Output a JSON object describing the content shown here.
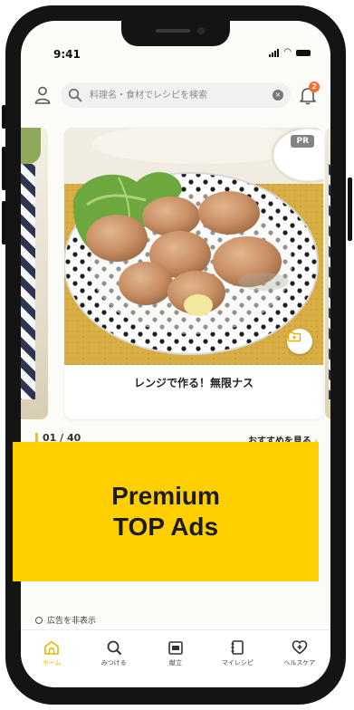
{
  "status_bar": {
    "time": "9:41"
  },
  "search": {
    "placeholder": "料理名・食材でレシピを検索"
  },
  "notifications": {
    "badge_count": "2"
  },
  "featured": {
    "pr_label": "PR",
    "recipe_title": "レンジで作る！無限ナス",
    "pager": "01 / 40",
    "see_more_label": "おすすめを見る"
  },
  "ad_banner": {
    "line1": "Premium",
    "line2": "TOP Ads"
  },
  "hide_ads_label": "広告を非表示",
  "tab_bar": {
    "items": [
      {
        "label": "ホーム",
        "icon": "home-icon",
        "active": true
      },
      {
        "label": "みつける",
        "icon": "search-icon",
        "active": false
      },
      {
        "label": "献立",
        "icon": "calendar-icon",
        "active": false
      },
      {
        "label": "マイレシピ",
        "icon": "notebook-icon",
        "active": false
      },
      {
        "label": "ヘルスケア",
        "icon": "heart-icon",
        "active": false
      }
    ]
  },
  "colors": {
    "accent": "#ffcf00",
    "badge": "#ff6a2f",
    "frame": "#141414"
  }
}
